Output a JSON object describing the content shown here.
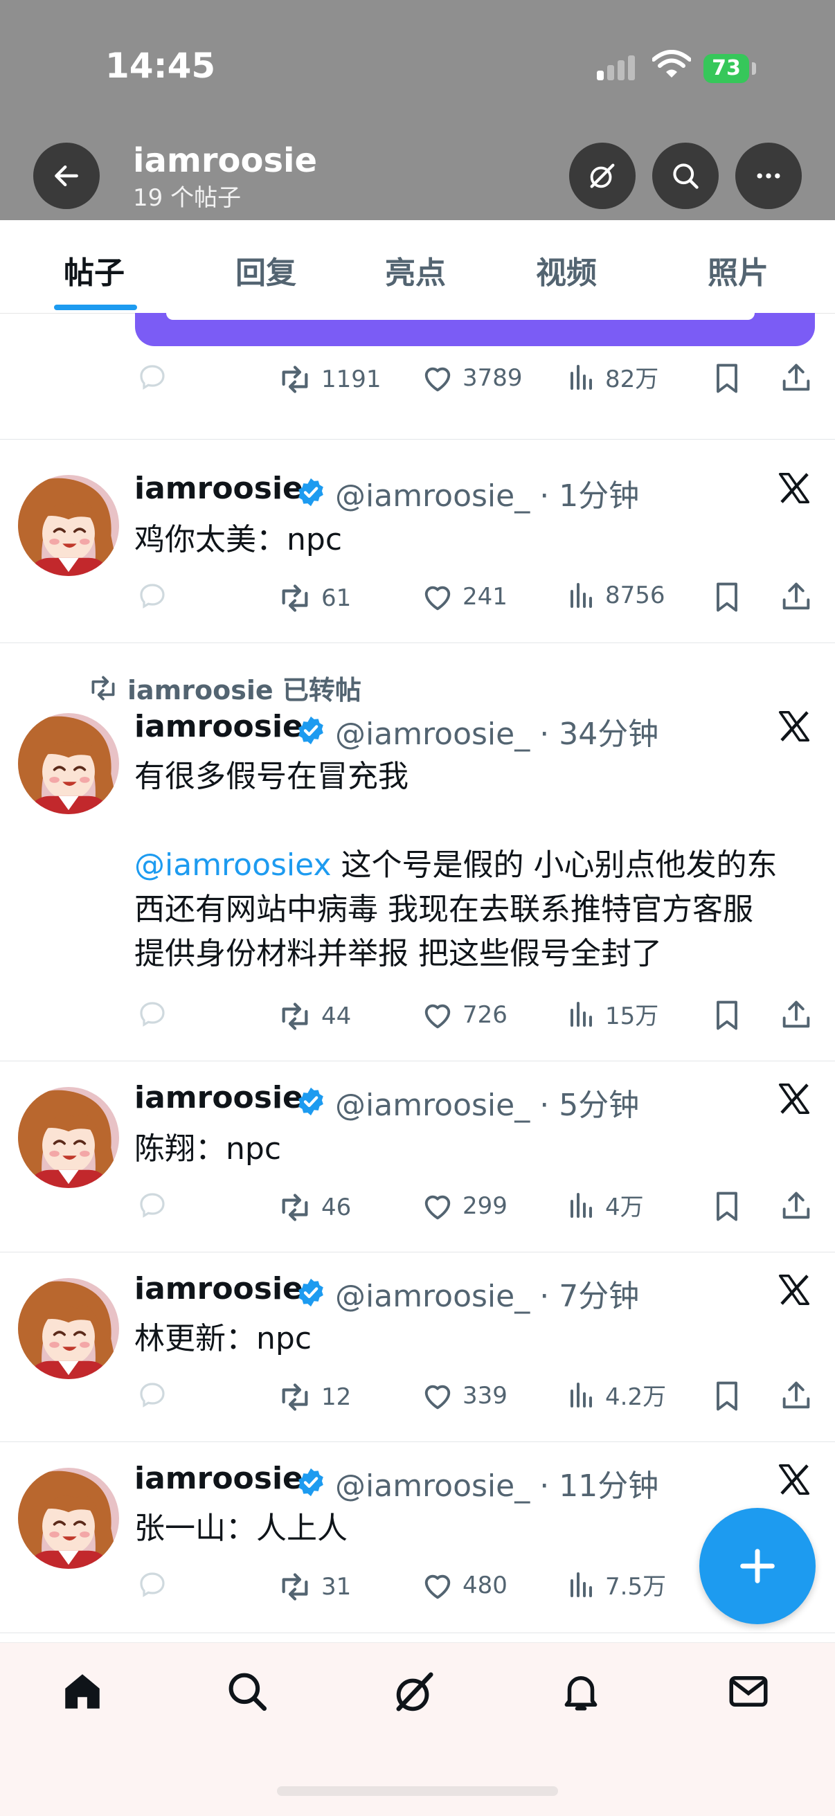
{
  "status_bar": {
    "time": "14:45",
    "battery": "73"
  },
  "header": {
    "name": "iamroosie",
    "post_count": "19 个帖子"
  },
  "tabs": [
    {
      "label": "帖子",
      "active": true
    },
    {
      "label": "回复"
    },
    {
      "label": "亮点"
    },
    {
      "label": "视频"
    },
    {
      "label": "照片"
    }
  ],
  "partial_post": {
    "retweets": "1191",
    "likes": "3789",
    "views": "82万"
  },
  "posts": [
    {
      "name": "iamroosie",
      "handle": "@iamroosie_",
      "time": "1分钟",
      "text": "鸡你太美：npc",
      "retweets": "61",
      "likes": "241",
      "views": "8756"
    },
    {
      "repost_label": "iamroosie 已转帖",
      "name": "iamroosie",
      "handle": "@iamroosie_",
      "time": "34分钟",
      "text_line1": "有很多假号在冒充我",
      "mention": "@iamroosiex",
      "text_line2": " 这个号是假的 小心别点他发的东",
      "text_line3": "西还有网站中病毒 我现在去联系推特官方客服",
      "text_line4": "提供身份材料并举报 把这些假号全封了",
      "retweets": "44",
      "likes": "726",
      "views": "15万"
    },
    {
      "name": "iamroosie",
      "handle": "@iamroosie_",
      "time": "5分钟",
      "text": "陈翔：npc",
      "retweets": "46",
      "likes": "299",
      "views": "4万"
    },
    {
      "name": "iamroosie",
      "handle": "@iamroosie_",
      "time": "7分钟",
      "text": "林更新：npc",
      "retweets": "12",
      "likes": "339",
      "views": "4.2万"
    },
    {
      "name": "iamroosie",
      "handle": "@iamroosie_",
      "time": "11分钟",
      "text": "张一山：人上人",
      "retweets": "31",
      "likes": "480",
      "views": "7.5万"
    }
  ],
  "colors": {
    "accent": "#1d9bf0",
    "verified": "#1d9bf0",
    "purple_card": "#7b5cf5"
  }
}
